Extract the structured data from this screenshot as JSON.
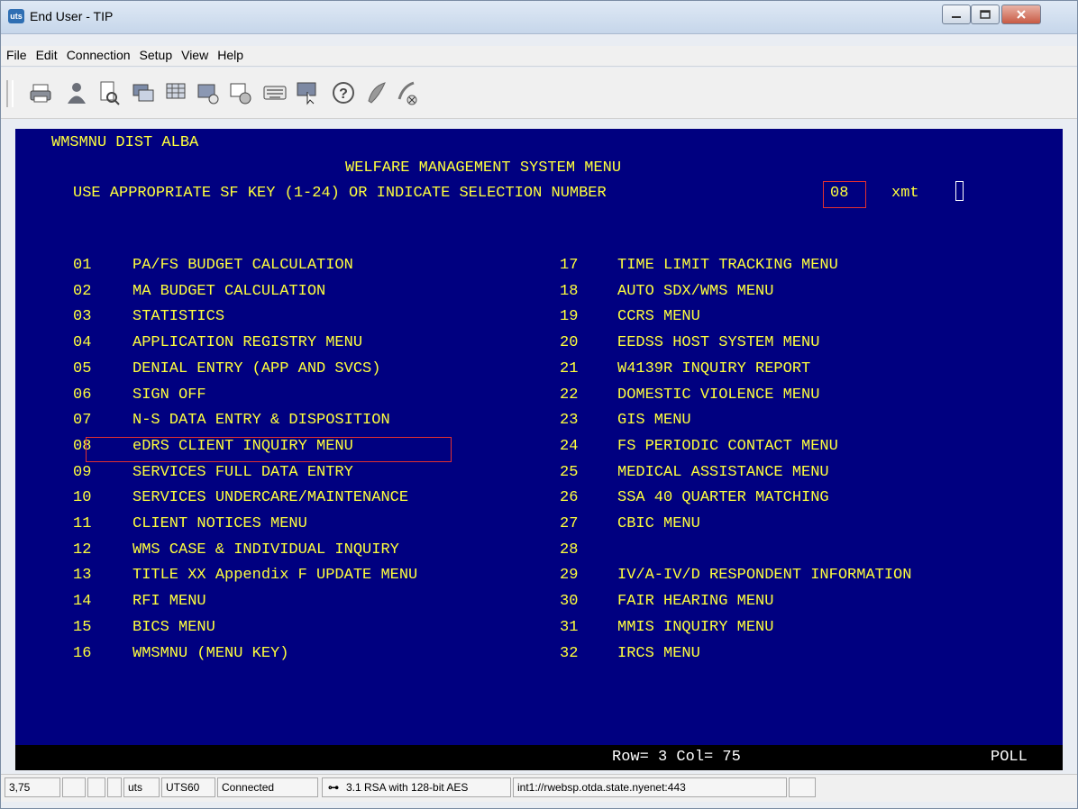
{
  "window": {
    "title": "End User - TIP",
    "app_icon": "uts"
  },
  "menubar": [
    "File",
    "Edit",
    "Connection",
    "Setup",
    "View",
    "Help"
  ],
  "toolbar_icons": [
    "print-icon",
    "person-icon",
    "document-search-icon",
    "screen-copy-icon",
    "screen-grid-icon",
    "screen-send-icon",
    "screen-settings-icon",
    "keyboard-icon",
    "screen-cursor-icon",
    "help-icon",
    "feather-icon",
    "disconnect-icon"
  ],
  "screen": {
    "header_left": "WMSMNU DIST ALBA",
    "title": "WELFARE MANAGEMENT SYSTEM MENU",
    "prompt": "USE APPROPRIATE SF KEY (1-24) OR INDICATE SELECTION NUMBER",
    "selection": "08",
    "xmt": "xmt",
    "left_items": [
      {
        "num": "01",
        "label": "PA/FS BUDGET CALCULATION"
      },
      {
        "num": "02",
        "label": "MA BUDGET CALCULATION"
      },
      {
        "num": "03",
        "label": "STATISTICS"
      },
      {
        "num": "04",
        "label": "APPLICATION REGISTRY MENU"
      },
      {
        "num": "05",
        "label": "DENIAL ENTRY (APP AND SVCS)"
      },
      {
        "num": "06",
        "label": "SIGN OFF"
      },
      {
        "num": "07",
        "label": "N-S DATA ENTRY & DISPOSITION"
      },
      {
        "num": "08",
        "label": "eDRS CLIENT INQUIRY MENU"
      },
      {
        "num": "09",
        "label": "SERVICES FULL DATA ENTRY"
      },
      {
        "num": "10",
        "label": "SERVICES UNDERCARE/MAINTENANCE"
      },
      {
        "num": "11",
        "label": "CLIENT NOTICES MENU"
      },
      {
        "num": "12",
        "label": "WMS CASE & INDIVIDUAL INQUIRY"
      },
      {
        "num": "13",
        "label": "TITLE XX Appendix F UPDATE MENU"
      },
      {
        "num": "14",
        "label": "RFI MENU"
      },
      {
        "num": "15",
        "label": "BICS MENU"
      },
      {
        "num": "16",
        "label": "WMSMNU (MENU KEY)"
      }
    ],
    "right_items": [
      {
        "num": "17",
        "label": "TIME LIMIT TRACKING MENU"
      },
      {
        "num": "18",
        "label": "AUTO SDX/WMS MENU"
      },
      {
        "num": "19",
        "label": "CCRS MENU"
      },
      {
        "num": "20",
        "label": "EEDSS HOST SYSTEM MENU"
      },
      {
        "num": "21",
        "label": "W4139R INQUIRY REPORT"
      },
      {
        "num": "22",
        "label": "DOMESTIC VIOLENCE MENU"
      },
      {
        "num": "23",
        "label": "GIS MENU"
      },
      {
        "num": "24",
        "label": "FS PERIODIC CONTACT MENU"
      },
      {
        "num": "25",
        "label": "MEDICAL ASSISTANCE MENU"
      },
      {
        "num": "26",
        "label": "SSA 40 QUARTER MATCHING"
      },
      {
        "num": "27",
        "label": "CBIC MENU"
      },
      {
        "num": "28",
        "label": ""
      },
      {
        "num": "29",
        "label": "IV/A-IV/D RESPONDENT INFORMATION"
      },
      {
        "num": "30",
        "label": "FAIR HEARING MENU"
      },
      {
        "num": "31",
        "label": "MMIS INQUIRY MENU"
      },
      {
        "num": "32",
        "label": "IRCS MENU"
      }
    ],
    "status_row_col": "Row= 3 Col= 75",
    "status_mode": "POLL"
  },
  "statusbar": {
    "cursor": "3,75",
    "uts": "uts",
    "terminal_type": "UTS60",
    "connection": "Connected",
    "encryption": "3.1 RSA with 128-bit AES",
    "host": "int1://rwebsp.otda.state.nyenet:443"
  },
  "colors": {
    "terminal_bg": "#000080",
    "terminal_text": "#ffff3c",
    "highlight_box": "#e23030"
  }
}
